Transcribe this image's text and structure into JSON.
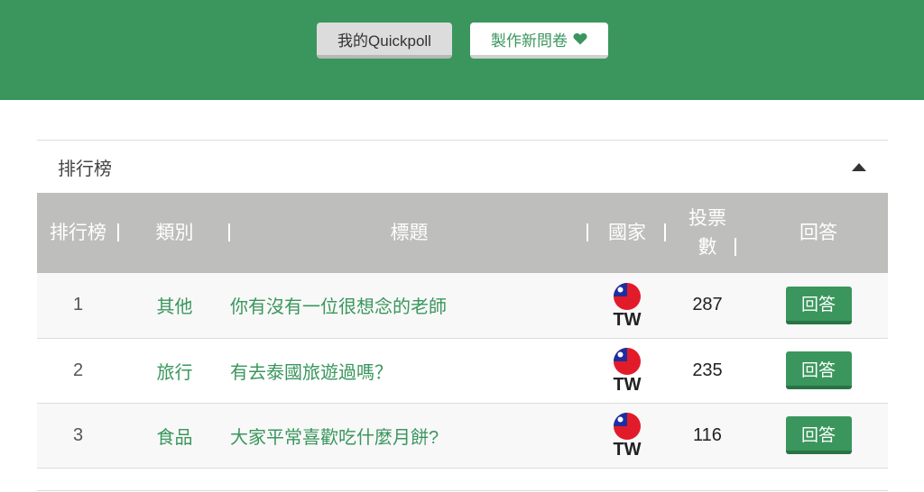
{
  "hero": {
    "my_quickpoll_label": "我的Quickpoll",
    "new_survey_label": "製作新問卷"
  },
  "panel": {
    "title": "排行榜"
  },
  "table": {
    "headers": {
      "rank": "排行榜",
      "category": "類別",
      "title": "標題",
      "country": "國家",
      "votes_line1": "投票",
      "votes_line2": "數",
      "answer": "回答"
    },
    "rows": [
      {
        "rank": "1",
        "category": "其他",
        "title": "你有沒有一位很想念的老師",
        "country": "TW",
        "votes": "287",
        "answer": "回答"
      },
      {
        "rank": "2",
        "category": "旅行",
        "title": "有去泰國旅遊過嗎？",
        "country": "TW",
        "votes": "235",
        "answer": "回答"
      },
      {
        "rank": "3",
        "category": "食品",
        "title": "大家平常喜歡吃什麼月餅?",
        "country": "TW",
        "votes": "116",
        "answer": "回答"
      }
    ]
  },
  "colors": {
    "brand_green": "#3a965d",
    "header_gray": "#bebebc"
  }
}
